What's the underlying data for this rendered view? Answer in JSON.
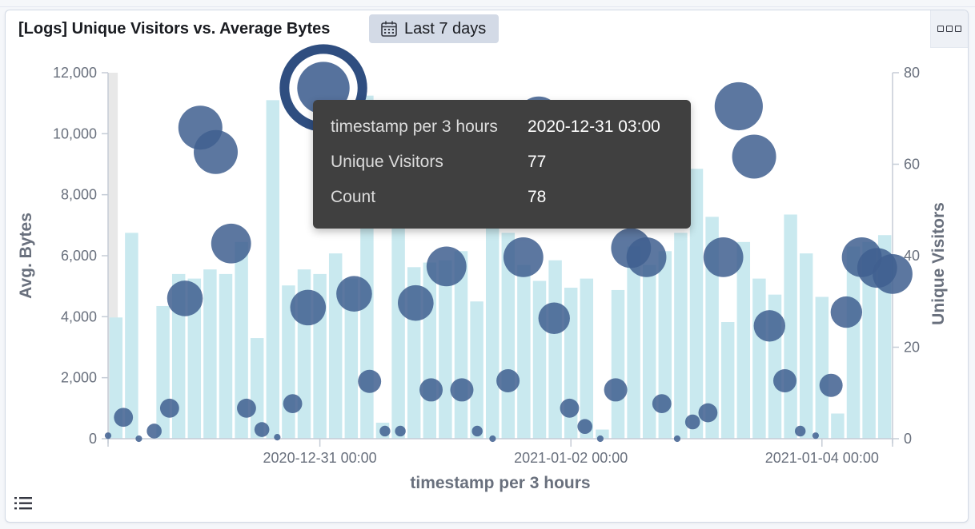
{
  "panel": {
    "title": "[Logs] Unique Visitors vs. Average Bytes",
    "time_range": "Last 7 days"
  },
  "icons": {
    "calendar": "calendar-icon",
    "panel_menu": "options-menu-icon",
    "legend": "legend-toggle-icon"
  },
  "tooltip": {
    "rows": [
      {
        "key": "timestamp per 3 hours",
        "value": "2020-12-31 03:00"
      },
      {
        "key": "Unique Visitors",
        "value": "77"
      },
      {
        "key": "Count",
        "value": "78"
      }
    ]
  },
  "colors": {
    "bars": "#c9e9ef",
    "bubbles": "#3f5f8f",
    "highlight_bar": "#e8e8e8",
    "tooltip_bg": "#404040"
  },
  "chart_data": {
    "type": "bar",
    "xlabel": "timestamp per 3 hours",
    "ylabel_left": "Avg. Bytes",
    "ylabel_right": "Unique Visitors",
    "x_ticks": [
      "2020-12-31 00:00",
      "2021-01-02 00:00",
      "2021-01-04 00:00"
    ],
    "x_tick_index": [
      13,
      29,
      45
    ],
    "y_left_ticks": [
      "0",
      "2,000",
      "4,000",
      "6,000",
      "8,000",
      "10,000",
      "12,000"
    ],
    "y_left_ticks_values": [
      0,
      2000,
      4000,
      6000,
      8000,
      10000,
      12000
    ],
    "y_right_ticks": [
      "0",
      "20",
      "40",
      "60",
      "80"
    ],
    "y_right_ticks_values": [
      0,
      20,
      40,
      60,
      80
    ],
    "ylim_left": [
      0,
      12000
    ],
    "ylim_right": [
      0,
      80
    ],
    "series": [
      {
        "name": "Unique Visitors",
        "axis": "right",
        "values": [
          26.5,
          45,
          0,
          29,
          36,
          35,
          37,
          36,
          43,
          22,
          74,
          33.5,
          37,
          36,
          40.5,
          35,
          75,
          3.5,
          50,
          37.5,
          38.5,
          39,
          41,
          30,
          55,
          45,
          38,
          34.5,
          39,
          33,
          35,
          2,
          32.5,
          42,
          38,
          41,
          45,
          59,
          48.5,
          25.5,
          43,
          35,
          31.5,
          49,
          40.5,
          31,
          5.5,
          42,
          43,
          44.5
        ]
      },
      {
        "name": "Avg. Bytes",
        "axis": "left",
        "values": [
          100,
          700,
          0,
          250,
          1000,
          4600,
          10200,
          9400,
          6400,
          1000,
          300,
          50,
          1150,
          4300,
          11500,
          10100,
          4750,
          1880,
          250,
          250,
          4450,
          1600,
          5650,
          1600,
          250,
          0,
          1900,
          5950,
          10500,
          3950,
          1000,
          400,
          0,
          1600,
          6250,
          5950,
          1150,
          0,
          550,
          850,
          5950,
          10900,
          9250,
          3700,
          1900,
          250,
          100,
          1750,
          4150,
          5950,
          5600,
          5400
        ],
        "sizes": [
          1,
          4,
          1,
          3,
          4,
          8,
          10,
          10,
          9,
          4,
          3,
          1,
          4,
          8,
          12,
          9,
          8,
          5,
          2,
          2,
          8,
          5,
          9,
          5,
          2,
          1,
          5,
          9,
          10,
          7,
          4,
          3,
          1,
          5,
          9,
          9,
          4,
          1,
          3,
          4,
          9,
          11,
          10,
          7,
          5,
          2,
          1,
          5,
          7,
          9,
          9,
          9
        ]
      }
    ]
  }
}
